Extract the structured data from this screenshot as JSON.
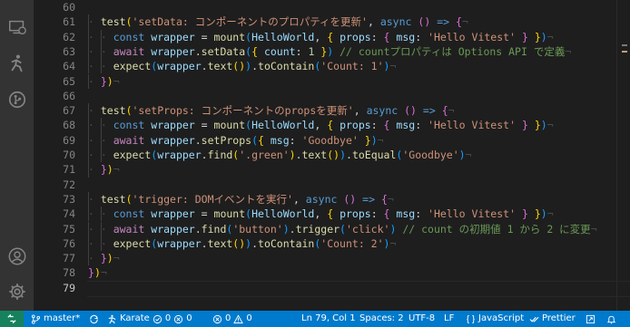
{
  "activity_bar": {
    "icons": [
      "remote-explorer-icon",
      "run-test-icon",
      "source-control-icon",
      "account-icon",
      "settings-gear-icon"
    ]
  },
  "editor": {
    "active_line": 79,
    "lines": [
      {
        "n": "60",
        "indent": 0,
        "tokens": []
      },
      {
        "n": "61",
        "indent": 1,
        "tokens": [
          [
            "func",
            "test"
          ],
          [
            "br1",
            "("
          ],
          [
            "str",
            "'setData: コンポーネントのプロパティを更新'"
          ],
          [
            "fg",
            ", "
          ],
          [
            "kw",
            "async"
          ],
          [
            "fg",
            " "
          ],
          [
            "br2",
            "()"
          ],
          [
            "fg",
            " "
          ],
          [
            "kw",
            "=>"
          ],
          [
            "fg",
            " "
          ],
          [
            "br2",
            "{"
          ]
        ]
      },
      {
        "n": "62",
        "indent": 2,
        "tokens": [
          [
            "kw",
            "const"
          ],
          [
            "fg",
            " "
          ],
          [
            "var",
            "wrapper"
          ],
          [
            "fg",
            " = "
          ],
          [
            "func",
            "mount"
          ],
          [
            "br3",
            "("
          ],
          [
            "var",
            "HelloWorld"
          ],
          [
            "fg",
            ", "
          ],
          [
            "br1",
            "{"
          ],
          [
            "fg",
            " "
          ],
          [
            "var",
            "props"
          ],
          [
            "fg",
            ": "
          ],
          [
            "br2",
            "{"
          ],
          [
            "fg",
            " "
          ],
          [
            "var",
            "msg"
          ],
          [
            "fg",
            ": "
          ],
          [
            "str",
            "'Hello Vitest'"
          ],
          [
            "fg",
            " "
          ],
          [
            "br2",
            "}"
          ],
          [
            "fg",
            " "
          ],
          [
            "br1",
            "}"
          ],
          [
            "br3",
            ")"
          ]
        ]
      },
      {
        "n": "63",
        "indent": 2,
        "tokens": [
          [
            "ctl",
            "await"
          ],
          [
            "fg",
            " "
          ],
          [
            "var",
            "wrapper"
          ],
          [
            "fg",
            "."
          ],
          [
            "func",
            "setData"
          ],
          [
            "br3",
            "("
          ],
          [
            "br1",
            "{"
          ],
          [
            "fg",
            " "
          ],
          [
            "var",
            "count"
          ],
          [
            "fg",
            ": "
          ],
          [
            "num",
            "1"
          ],
          [
            "fg",
            " "
          ],
          [
            "br1",
            "}"
          ],
          [
            "br3",
            ")"
          ],
          [
            "fg",
            " "
          ],
          [
            "com",
            "// countプロパティは Options API で定義"
          ]
        ]
      },
      {
        "n": "64",
        "indent": 2,
        "tokens": [
          [
            "func",
            "expect"
          ],
          [
            "br3",
            "("
          ],
          [
            "var",
            "wrapper"
          ],
          [
            "fg",
            "."
          ],
          [
            "func",
            "text"
          ],
          [
            "br1",
            "()"
          ],
          [
            "br3",
            ")"
          ],
          [
            "fg",
            "."
          ],
          [
            "func",
            "toContain"
          ],
          [
            "br3",
            "("
          ],
          [
            "str",
            "'Count: 1'"
          ],
          [
            "br3",
            ")"
          ]
        ]
      },
      {
        "n": "65",
        "indent": 1,
        "tokens": [
          [
            "br2",
            "}"
          ],
          [
            "br1",
            ")"
          ]
        ]
      },
      {
        "n": "66",
        "indent": 0,
        "tokens": []
      },
      {
        "n": "67",
        "indent": 1,
        "tokens": [
          [
            "func",
            "test"
          ],
          [
            "br1",
            "("
          ],
          [
            "str",
            "'setProps: コンポーネントのpropsを更新'"
          ],
          [
            "fg",
            ", "
          ],
          [
            "kw",
            "async"
          ],
          [
            "fg",
            " "
          ],
          [
            "br2",
            "()"
          ],
          [
            "fg",
            " "
          ],
          [
            "kw",
            "=>"
          ],
          [
            "fg",
            " "
          ],
          [
            "br2",
            "{"
          ]
        ]
      },
      {
        "n": "68",
        "indent": 2,
        "tokens": [
          [
            "kw",
            "const"
          ],
          [
            "fg",
            " "
          ],
          [
            "var",
            "wrapper"
          ],
          [
            "fg",
            " = "
          ],
          [
            "func",
            "mount"
          ],
          [
            "br3",
            "("
          ],
          [
            "var",
            "HelloWorld"
          ],
          [
            "fg",
            ", "
          ],
          [
            "br1",
            "{"
          ],
          [
            "fg",
            " "
          ],
          [
            "var",
            "props"
          ],
          [
            "fg",
            ": "
          ],
          [
            "br2",
            "{"
          ],
          [
            "fg",
            " "
          ],
          [
            "var",
            "msg"
          ],
          [
            "fg",
            ": "
          ],
          [
            "str",
            "'Hello Vitest'"
          ],
          [
            "fg",
            " "
          ],
          [
            "br2",
            "}"
          ],
          [
            "fg",
            " "
          ],
          [
            "br1",
            "}"
          ],
          [
            "br3",
            ")"
          ]
        ]
      },
      {
        "n": "69",
        "indent": 2,
        "tokens": [
          [
            "ctl",
            "await"
          ],
          [
            "fg",
            " "
          ],
          [
            "var",
            "wrapper"
          ],
          [
            "fg",
            "."
          ],
          [
            "func",
            "setProps"
          ],
          [
            "br3",
            "("
          ],
          [
            "br1",
            "{"
          ],
          [
            "fg",
            " "
          ],
          [
            "var",
            "msg"
          ],
          [
            "fg",
            ": "
          ],
          [
            "str",
            "'Goodbye'"
          ],
          [
            "fg",
            " "
          ],
          [
            "br1",
            "}"
          ],
          [
            "br3",
            ")"
          ]
        ]
      },
      {
        "n": "70",
        "indent": 2,
        "tokens": [
          [
            "func",
            "expect"
          ],
          [
            "br3",
            "("
          ],
          [
            "var",
            "wrapper"
          ],
          [
            "fg",
            "."
          ],
          [
            "func",
            "find"
          ],
          [
            "br1",
            "("
          ],
          [
            "str",
            "'.green'"
          ],
          [
            "br1",
            ")"
          ],
          [
            "fg",
            "."
          ],
          [
            "func",
            "text"
          ],
          [
            "br1",
            "()"
          ],
          [
            "br3",
            ")"
          ],
          [
            "fg",
            "."
          ],
          [
            "func",
            "toEqual"
          ],
          [
            "br3",
            "("
          ],
          [
            "str",
            "'Goodbye'"
          ],
          [
            "br3",
            ")"
          ]
        ]
      },
      {
        "n": "71",
        "indent": 1,
        "tokens": [
          [
            "br2",
            "}"
          ],
          [
            "br1",
            ")"
          ]
        ]
      },
      {
        "n": "72",
        "indent": 0,
        "tokens": []
      },
      {
        "n": "73",
        "indent": 1,
        "tokens": [
          [
            "func",
            "test"
          ],
          [
            "br1",
            "("
          ],
          [
            "str",
            "'trigger: DOMイベントを実行'"
          ],
          [
            "fg",
            ", "
          ],
          [
            "kw",
            "async"
          ],
          [
            "fg",
            " "
          ],
          [
            "br2",
            "()"
          ],
          [
            "fg",
            " "
          ],
          [
            "kw",
            "=>"
          ],
          [
            "fg",
            " "
          ],
          [
            "br2",
            "{"
          ]
        ]
      },
      {
        "n": "74",
        "indent": 2,
        "tokens": [
          [
            "kw",
            "const"
          ],
          [
            "fg",
            " "
          ],
          [
            "var",
            "wrapper"
          ],
          [
            "fg",
            " = "
          ],
          [
            "func",
            "mount"
          ],
          [
            "br3",
            "("
          ],
          [
            "var",
            "HelloWorld"
          ],
          [
            "fg",
            ", "
          ],
          [
            "br1",
            "{"
          ],
          [
            "fg",
            " "
          ],
          [
            "var",
            "props"
          ],
          [
            "fg",
            ": "
          ],
          [
            "br2",
            "{"
          ],
          [
            "fg",
            " "
          ],
          [
            "var",
            "msg"
          ],
          [
            "fg",
            ": "
          ],
          [
            "str",
            "'Hello Vitest'"
          ],
          [
            "fg",
            " "
          ],
          [
            "br2",
            "}"
          ],
          [
            "fg",
            " "
          ],
          [
            "br1",
            "}"
          ],
          [
            "br3",
            ")"
          ]
        ]
      },
      {
        "n": "75",
        "indent": 2,
        "tokens": [
          [
            "ctl",
            "await"
          ],
          [
            "fg",
            " "
          ],
          [
            "var",
            "wrapper"
          ],
          [
            "fg",
            "."
          ],
          [
            "func",
            "find"
          ],
          [
            "br3",
            "("
          ],
          [
            "str",
            "'button'"
          ],
          [
            "br3",
            ")"
          ],
          [
            "fg",
            "."
          ],
          [
            "func",
            "trigger"
          ],
          [
            "br3",
            "("
          ],
          [
            "str",
            "'click'"
          ],
          [
            "br3",
            ")"
          ],
          [
            "fg",
            " "
          ],
          [
            "com",
            "// count の初期値 1 から 2 に変更"
          ]
        ]
      },
      {
        "n": "76",
        "indent": 2,
        "tokens": [
          [
            "func",
            "expect"
          ],
          [
            "br3",
            "("
          ],
          [
            "var",
            "wrapper"
          ],
          [
            "fg",
            "."
          ],
          [
            "func",
            "text"
          ],
          [
            "br1",
            "()"
          ],
          [
            "br3",
            ")"
          ],
          [
            "fg",
            "."
          ],
          [
            "func",
            "toContain"
          ],
          [
            "br3",
            "("
          ],
          [
            "str",
            "'Count: 2'"
          ],
          [
            "br3",
            ")"
          ]
        ]
      },
      {
        "n": "77",
        "indent": 1,
        "tokens": [
          [
            "br2",
            "}"
          ],
          [
            "br1",
            ")"
          ]
        ]
      },
      {
        "n": "78",
        "indent": 0,
        "tokens": [
          [
            "br2",
            "}"
          ],
          [
            "br1",
            ")"
          ]
        ]
      },
      {
        "n": "79",
        "indent": 0,
        "tokens": []
      }
    ]
  },
  "statusbar": {
    "branch": "master*",
    "karate": "Karate",
    "karate_passed": "0",
    "karate_failed": "0",
    "errors": "0",
    "warnings": "0",
    "position": "Ln 79, Col 1",
    "spaces": "Spaces: 2",
    "encoding": "UTF-8",
    "eol": "LF",
    "language": "JavaScript",
    "formatter": "Prettier",
    "colors": {
      "background": "#007acc",
      "remote": "#16825d"
    }
  }
}
